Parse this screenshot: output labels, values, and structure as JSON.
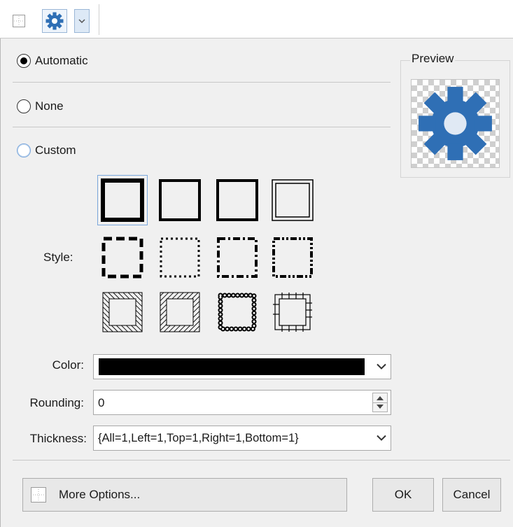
{
  "toolbar": {
    "border_icon": "border-icon",
    "gear_icon": "gear-icon",
    "dropdown_icon": "chevron-down-icon"
  },
  "options": {
    "automatic": "Automatic",
    "none": "None",
    "custom": "Custom",
    "selected": "automatic"
  },
  "preview": {
    "label": "Preview",
    "icon": "gear-icon",
    "icon_color": "#2f6fb5"
  },
  "style": {
    "label": "Style:",
    "items": [
      "solid-thick",
      "solid",
      "solid-medium",
      "double",
      "dashed",
      "dotted",
      "dash-dot",
      "dash-dot-dot",
      "hatched-left",
      "hatched-right",
      "beaded",
      "railroad"
    ],
    "selected_index": 0
  },
  "color": {
    "label": "Color:",
    "value": "#000000"
  },
  "rounding": {
    "label": "Rounding:",
    "value": "0"
  },
  "thickness": {
    "label": "Thickness:",
    "value": "{All=1,Left=1,Top=1,Right=1,Bottom=1}"
  },
  "buttons": {
    "more_options": "More Options...",
    "ok": "OK",
    "cancel": "Cancel"
  },
  "colors": {
    "accent": "#2f6fb5",
    "focus": "#7aa7dc"
  }
}
